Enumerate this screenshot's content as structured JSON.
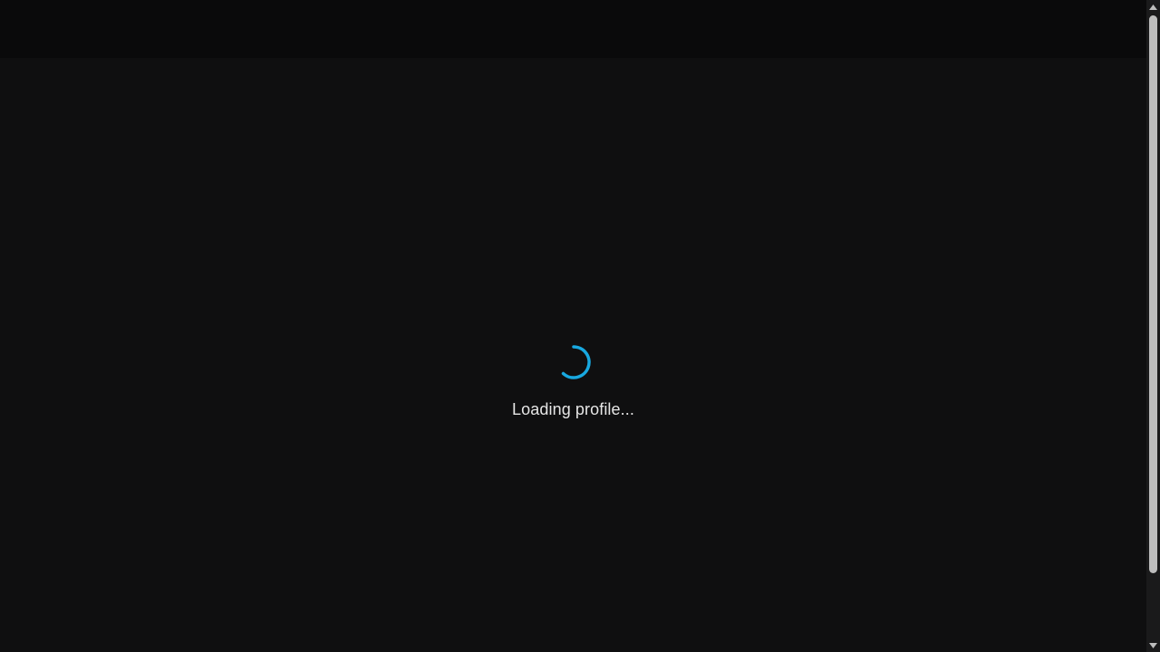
{
  "loading": {
    "text": "Loading profile...",
    "spinner_color": "#18a8e0",
    "spinner_icon": "loading-spinner-icon"
  },
  "colors": {
    "background": "#0f0f10",
    "topbar": "#0a0a0b",
    "text": "#e6e6e6"
  },
  "scrollbar": {
    "up_icon": "chevron-up-icon",
    "down_icon": "chevron-down-icon"
  }
}
